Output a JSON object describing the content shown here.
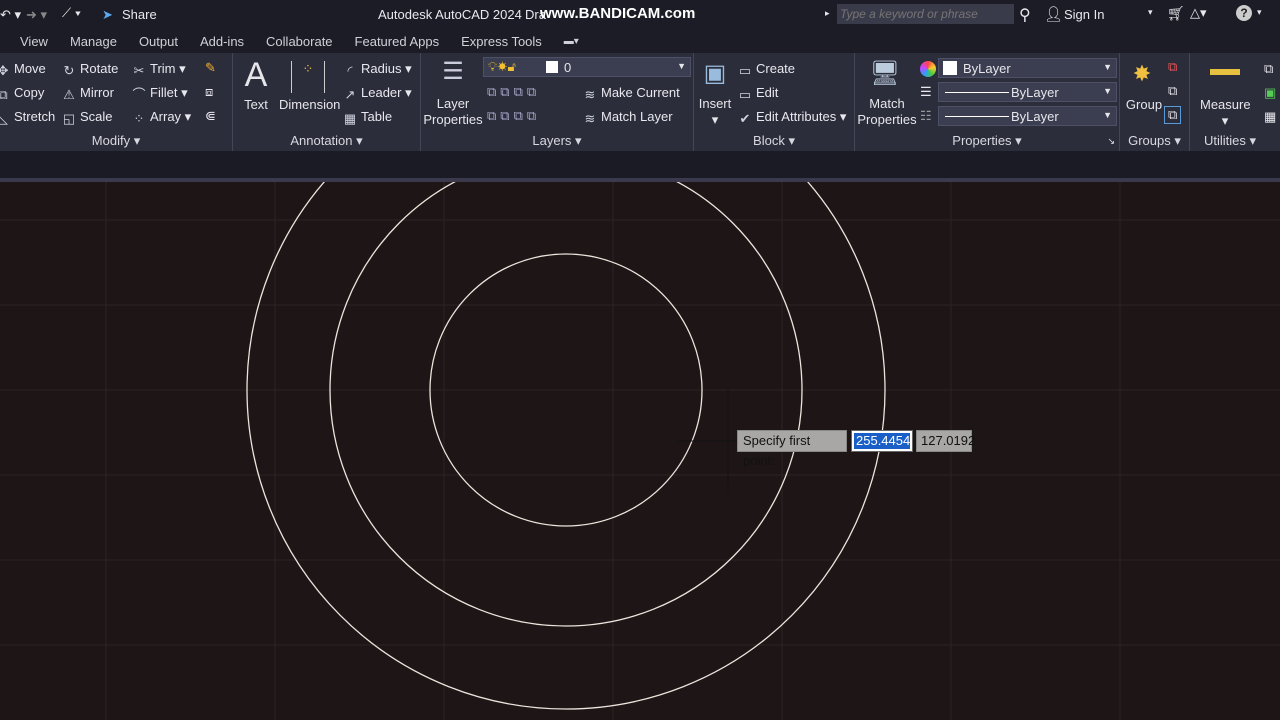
{
  "titlebar": {
    "share": "Share",
    "app_title": "Autodesk AutoCAD 2024",
    "doc_title": "Dra",
    "watermark": "www.BANDICAM.com",
    "search_placeholder": "Type a keyword or phrase",
    "sign_in": "Sign In"
  },
  "tabs": [
    "View",
    "Manage",
    "Output",
    "Add-ins",
    "Collaborate",
    "Featured Apps",
    "Express Tools"
  ],
  "modify": {
    "title": "Modify",
    "items": [
      "Move",
      "Rotate",
      "Trim",
      "Copy",
      "Mirror",
      "Fillet",
      "Stretch",
      "Scale",
      "Array"
    ]
  },
  "annotation": {
    "title": "Annotation",
    "text": "Text",
    "dimension": "Dimension",
    "radius": "Radius",
    "leader": "Leader",
    "table": "Table"
  },
  "layers": {
    "title": "Layers",
    "layer_properties_1": "Layer",
    "layer_properties_2": "Properties",
    "current_layer": "0",
    "make_current": "Make Current",
    "match_layer": "Match Layer"
  },
  "block": {
    "title": "Block",
    "insert": "Insert",
    "create": "Create",
    "edit": "Edit",
    "edit_attributes": "Edit Attributes"
  },
  "properties": {
    "title": "Properties",
    "match_1": "Match",
    "match_2": "Properties",
    "color": "ByLayer",
    "linetype": "ByLayer",
    "lineweight": "ByLayer"
  },
  "groups": {
    "title": "Groups",
    "group": "Group"
  },
  "utilities": {
    "title": "Utilities",
    "measure": "Measure"
  },
  "prompt": {
    "label": "Specify first point:",
    "x_value": "255.4454",
    "y_value": "127.0192"
  }
}
